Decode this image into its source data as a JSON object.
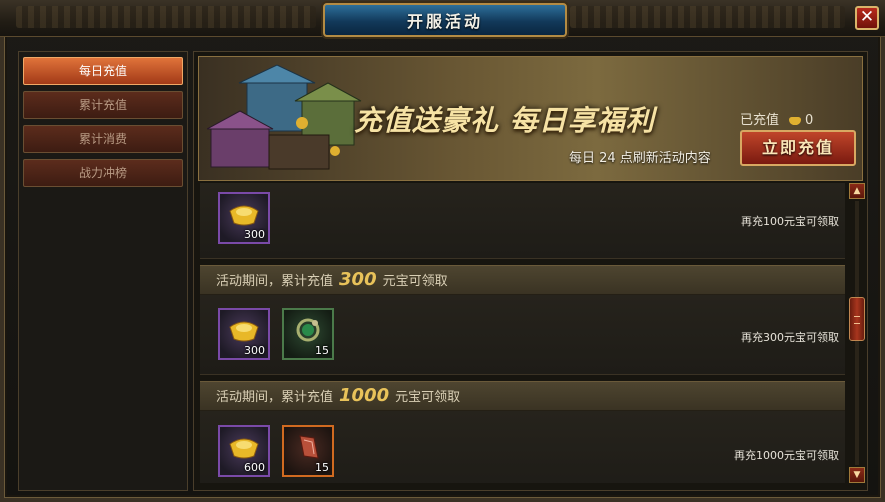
{
  "window": {
    "title": "开服活动",
    "close_label": "✕"
  },
  "sidebar": {
    "items": [
      {
        "label": "每日充值",
        "active": true
      },
      {
        "label": "累计充值",
        "active": false
      },
      {
        "label": "累计消费",
        "active": false
      },
      {
        "label": "战力冲榜",
        "active": false
      }
    ]
  },
  "banner": {
    "title": "充值送豪礼  每日享福利",
    "subtitle": "每日 24 点刷新活动内容",
    "recharged_label": "已充值",
    "recharged_value": "0",
    "recharge_button": "立即充值"
  },
  "rewards": [
    {
      "header": null,
      "items": [
        {
          "icon": "gold-ingot-icon",
          "count": "300",
          "rarity": "purple"
        }
      ],
      "hint": "再充100元宝可领取"
    },
    {
      "header": {
        "prefix": "活动期间，累计充值",
        "amount": "300",
        "suffix": "元宝可领取"
      },
      "items": [
        {
          "icon": "gold-ingot-icon",
          "count": "300",
          "rarity": "purple"
        },
        {
          "icon": "jade-dragon-ring-icon",
          "count": "15",
          "rarity": "green"
        }
      ],
      "hint": "再充300元宝可领取"
    },
    {
      "header": {
        "prefix": "活动期间，累计充值",
        "amount": "1000",
        "suffix": "元宝可领取"
      },
      "items": [
        {
          "icon": "gold-ingot-icon",
          "count": "600",
          "rarity": "purple"
        },
        {
          "icon": "red-scroll-icon",
          "count": "15",
          "rarity": "orange"
        }
      ],
      "hint": "再充1000元宝可领取"
    }
  ],
  "scrollbar": {
    "up_icon": "▲",
    "down_icon": "▼"
  },
  "colors": {
    "accent_gold": "#e8c25a",
    "active_tab": "#e0733a",
    "title_plate": "#2d6f9a"
  }
}
